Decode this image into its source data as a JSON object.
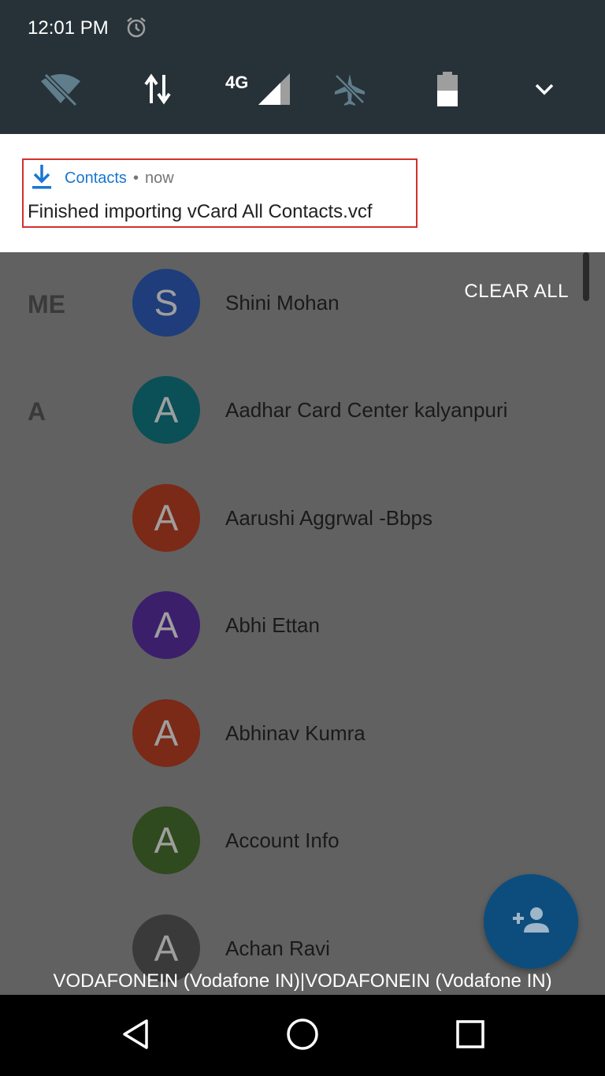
{
  "status_bar": {
    "time": "12:01 PM",
    "alarm_icon": "alarm-icon"
  },
  "quick_settings": {
    "network_label": "4G",
    "icons": [
      "wifi-off-icon",
      "data-transfer-icon",
      "cell-signal-icon",
      "airplane-mode-icon",
      "battery-icon",
      "chevron-down-icon"
    ]
  },
  "notification": {
    "app_name": "Contacts",
    "separator": "•",
    "time": "now",
    "text": "Finished importing vCard All Contacts.vcf",
    "icon": "download-icon",
    "highlight_color": "#d32f2f",
    "app_color": "#1976d2"
  },
  "clear_all_label": "CLEAR ALL",
  "contacts": {
    "sections": [
      {
        "label": "ME"
      },
      {
        "label": "A"
      }
    ],
    "items": [
      {
        "initial": "S",
        "name": "Shini Mohan",
        "color": "#1f3d7a"
      },
      {
        "initial": "A",
        "name": "Aadhar Card Center kalyanpuri",
        "color": "#0b4f57"
      },
      {
        "initial": "A",
        "name": "Aarushi Aggrwal -Bbps",
        "color": "#7a2a17"
      },
      {
        "initial": "A",
        "name": "Abhi Ettan",
        "color": "#3c1f6b"
      },
      {
        "initial": "A",
        "name": "Abhinav Kumra",
        "color": "#7a2a17"
      },
      {
        "initial": "A",
        "name": "Account Info",
        "color": "#2f4a1e"
      },
      {
        "initial": "A",
        "name": "Achan Ravi",
        "color": "#3a3a3a"
      }
    ]
  },
  "fab_icon": "add-person-icon",
  "carrier_text": "VODAFONEIN (Vodafone IN)|VODAFONEIN (Vodafone IN)",
  "nav": {
    "back_icon": "back-icon",
    "home_icon": "home-icon",
    "recents_icon": "recents-icon"
  }
}
